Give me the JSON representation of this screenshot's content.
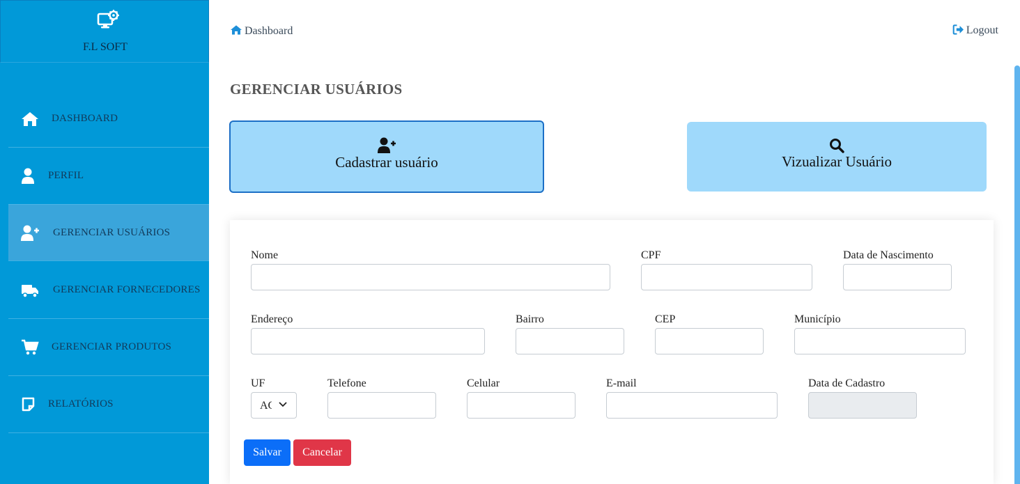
{
  "brand": {
    "name": "F.L SOFT"
  },
  "sidebar": {
    "items": [
      {
        "label": "DASHBOARD",
        "icon": "home-icon"
      },
      {
        "label": "PERFIL",
        "icon": "user-icon"
      },
      {
        "label": "GERENCIAR USUÁRIOS",
        "icon": "user-plus-icon",
        "active": true
      },
      {
        "label": "GERENCIAR FORNECEDORES",
        "icon": "truck-icon"
      },
      {
        "label": "GERENCIAR PRODUTOS",
        "icon": "cart-icon"
      },
      {
        "label": "RELATÓRIOS",
        "icon": "note-icon"
      }
    ]
  },
  "header": {
    "breadcrumb": "Dashboard",
    "logout": "Logout"
  },
  "page": {
    "title": "GERENCIAR USUÁRIOS",
    "cadastrar": "Cadastrar usuário",
    "vizualizar": "Vizualizar Usuário"
  },
  "form": {
    "nome": "Nome",
    "cpf": "CPF",
    "nascimento": "Data de Nascimento",
    "endereco": "Endereço",
    "bairro": "Bairro",
    "cep": "CEP",
    "municipio": "Município",
    "uf": "UF",
    "uf_value": "AC",
    "telefone": "Telefone",
    "celular": "Celular",
    "email": "E-mail",
    "cadastro": "Data de Cadastro",
    "salvar": "Salvar",
    "cancelar": "Cancelar"
  },
  "colors": {
    "sidebar": "#0199d8",
    "accent_button": "#9fd9fb",
    "primary": "#0b6ef8",
    "danger": "#e03648"
  }
}
